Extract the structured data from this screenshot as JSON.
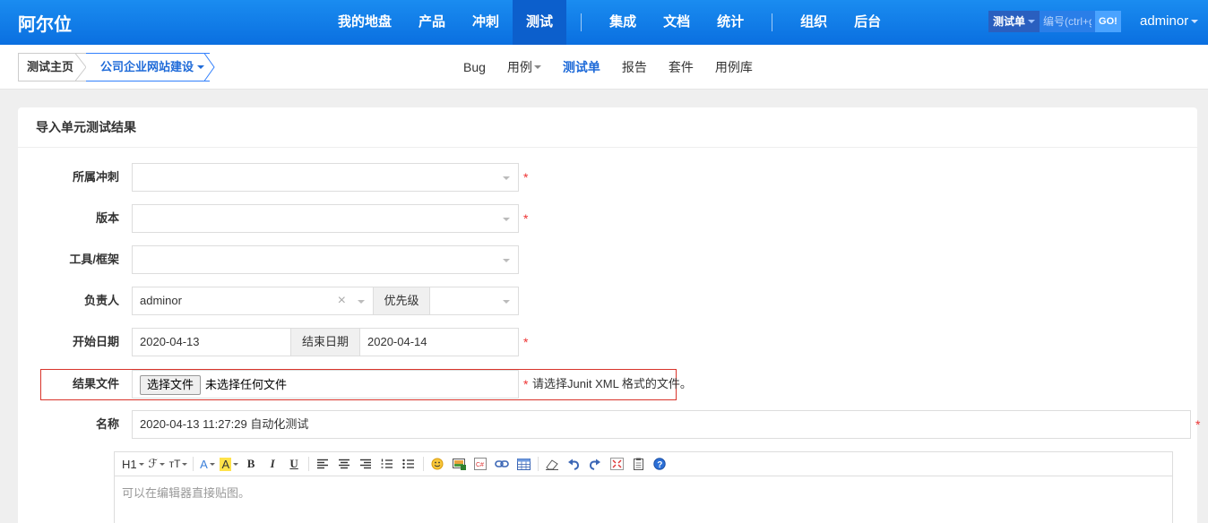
{
  "brand": "阿尔位",
  "nav": {
    "items": [
      "我的地盘",
      "产品",
      "冲刺",
      "测试",
      "集成",
      "文档",
      "统计",
      "组织",
      "后台"
    ],
    "active": "测试"
  },
  "search": {
    "type_label": "测试单",
    "placeholder": "编号(ctrl+g)",
    "go_label": "GO!"
  },
  "user": {
    "name": "adminor"
  },
  "breadcrumb": {
    "home": "测试主页",
    "project": "公司企业网站建设"
  },
  "subnav": {
    "items": [
      "Bug",
      "用例",
      "测试单",
      "报告",
      "套件",
      "用例库"
    ],
    "active": "测试单"
  },
  "panel": {
    "title": "导入单元测试结果"
  },
  "form": {
    "sprint_label": "所属冲刺",
    "build_label": "版本",
    "tool_label": "工具/框架",
    "owner_label": "负责人",
    "owner_value": "adminor",
    "priority_label": "优先级",
    "begin_label": "开始日期",
    "begin_value": "2020-04-13",
    "end_label": "结束日期",
    "end_value": "2020-04-14",
    "file_label": "结果文件",
    "file_button": "选择文件",
    "file_none": "未选择任何文件",
    "file_hint": "请选择Junit XML 格式的文件。",
    "name_label": "名称",
    "name_value": "2020-04-13 11:27:29 自动化测试",
    "required_mark": "*",
    "clear_mark": "×"
  },
  "editor": {
    "placeholder": "可以在编辑器直接贴图。",
    "toolbar": {
      "heading": "H1",
      "font": "ℱ",
      "size": "тT",
      "font_color": "A",
      "bg_color": "A",
      "bold": "B",
      "italic": "I",
      "underline": "U"
    }
  },
  "colors": {
    "topbar": "#0a6fe0",
    "accent": "#1e6ad8",
    "required": "#e33333",
    "highlight_border": "#d9342b"
  }
}
